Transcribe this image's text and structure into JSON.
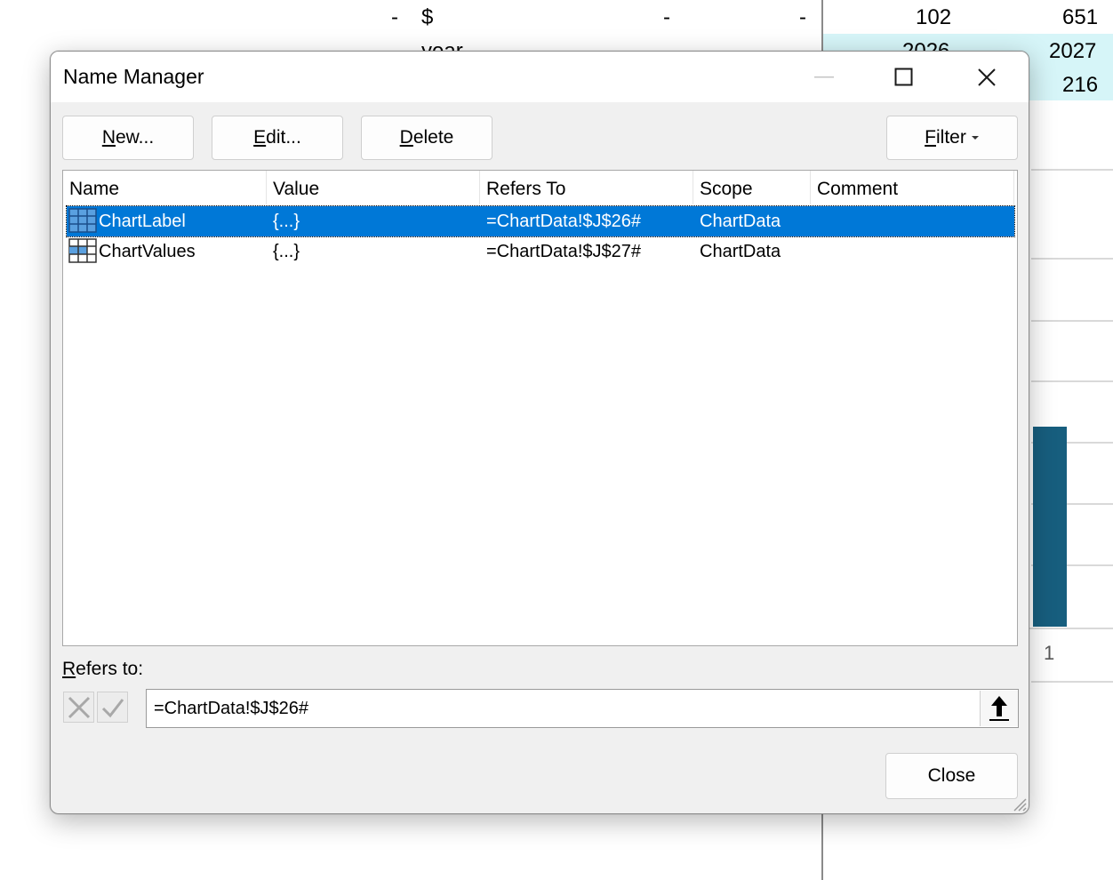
{
  "sheet": {
    "row1": {
      "dash_a": "-",
      "dollar": "$",
      "dash_b": "-",
      "dash_c": "-",
      "val1": "102",
      "val2": "651"
    },
    "row2": {
      "label": "year",
      "year1": "2026",
      "year2": "2027"
    },
    "row3": {
      "val2": "216"
    },
    "chart_axis_label": "1",
    "colors": {
      "highlight": "#d6f5f8",
      "bar": "#175e7e"
    }
  },
  "dialog": {
    "title": "Name Manager",
    "buttons": {
      "new_u": "N",
      "new_rest": "ew...",
      "edit_u": "E",
      "edit_rest": "dit...",
      "delete_u": "D",
      "delete_rest": "elete",
      "filter_u": "F",
      "filter_rest": "ilter"
    },
    "columns": [
      "Name",
      "Value",
      "Refers To",
      "Scope",
      "Comment"
    ],
    "rows": [
      {
        "name": "ChartLabel",
        "value": "{...}",
        "refers_to": "=ChartData!$J$26#",
        "scope": "ChartData",
        "comment": "",
        "selected": true,
        "icon": "range-table-icon"
      },
      {
        "name": "ChartValues",
        "value": "{...}",
        "refers_to": "=ChartData!$J$27#",
        "scope": "ChartData",
        "comment": "",
        "selected": false,
        "icon": "range-table-icon"
      }
    ],
    "refers_to_label_u": "R",
    "refers_to_label_rest": "efers to:",
    "refers_to_value": "=ChartData!$J$26#",
    "close_label": "Close",
    "accent": "#0078d7"
  }
}
